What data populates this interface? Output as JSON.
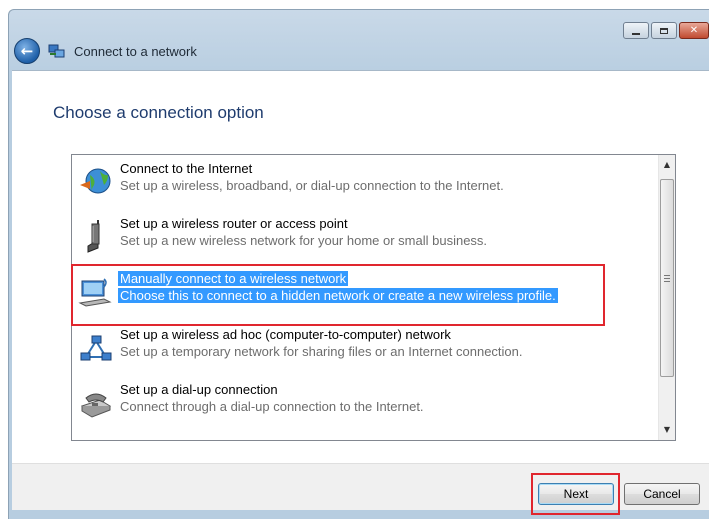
{
  "window": {
    "title": "Connect to a network",
    "controls": {
      "minimize": "",
      "maximize": "",
      "close": "✕"
    }
  },
  "page": {
    "heading": "Choose a connection option"
  },
  "options": [
    {
      "title": "Connect to the Internet",
      "description": "Set up a wireless, broadband, or dial-up connection to the Internet.",
      "icon": "globe-internet-icon",
      "selected": false
    },
    {
      "title": "Set up a wireless router or access point",
      "description": "Set up a new wireless network for your home or small business.",
      "icon": "wireless-router-icon",
      "selected": false
    },
    {
      "title": "Manually connect to a wireless network",
      "description": "Choose this to connect to a hidden network or create a new wireless profile.",
      "icon": "wireless-computer-icon",
      "selected": true
    },
    {
      "title": "Set up a wireless ad hoc (computer-to-computer) network",
      "description": "Set up a temporary network for sharing files or an Internet connection.",
      "icon": "adhoc-network-icon",
      "selected": false
    },
    {
      "title": "Set up a dial-up connection",
      "description": "Connect through a dial-up connection to the Internet.",
      "icon": "dialup-phone-icon",
      "selected": false
    }
  ],
  "scrollbar": {
    "up": "▲",
    "down": "▼"
  },
  "buttons": {
    "next": "Next",
    "cancel": "Cancel"
  },
  "colors": {
    "selection": "#3399ff",
    "annotation": "#e0262e",
    "heading": "#1f3c6e"
  }
}
